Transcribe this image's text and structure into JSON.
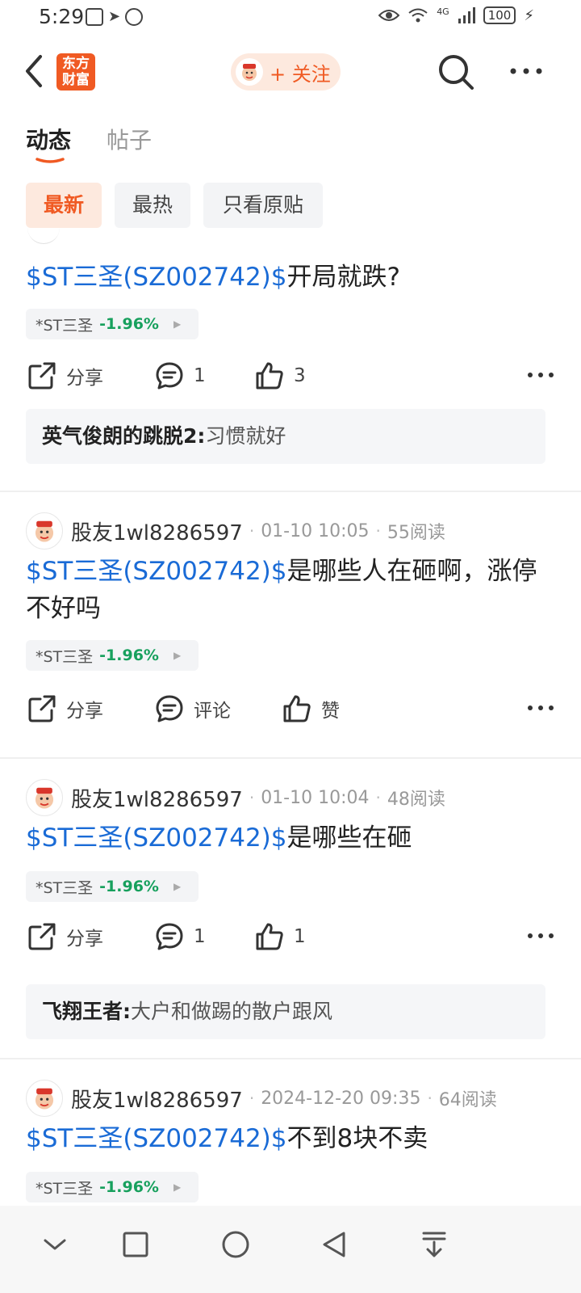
{
  "status_bar": {
    "time": "5:29",
    "network": "4G",
    "battery": "100"
  },
  "header": {
    "logo_line1": "东方",
    "logo_line2": "财富",
    "follow_label": "+ 关注"
  },
  "tabs": [
    {
      "label": "动态"
    },
    {
      "label": "帖子"
    }
  ],
  "filters": [
    {
      "label": "最新"
    },
    {
      "label": "最热"
    },
    {
      "label": "只看原贴"
    }
  ],
  "posts": [
    {
      "stock_code": "$ST三圣(SZ002742)$",
      "text": "开局就跌?",
      "tag_name": "*ST三圣",
      "tag_change": "-1.96%",
      "share_label": "分享",
      "comment_label": "1",
      "like_label": "3",
      "comment_author": "英气俊朗的跳脱2:",
      "comment_text": "习惯就好"
    },
    {
      "author": "股友1wl8286597",
      "time": "01-10 10:05",
      "reads": "55阅读",
      "stock_code": "$ST三圣(SZ002742)$",
      "text": "是哪些人在砸啊，涨停不好吗",
      "tag_name": "*ST三圣",
      "tag_change": "-1.96%",
      "share_label": "分享",
      "comment_label": "评论",
      "like_label": "赞"
    },
    {
      "author": "股友1wl8286597",
      "time": "01-10 10:04",
      "reads": "48阅读",
      "stock_code": "$ST三圣(SZ002742)$",
      "text": "是哪些在砸",
      "tag_name": "*ST三圣",
      "tag_change": "-1.96%",
      "share_label": "分享",
      "comment_label": "1",
      "like_label": "1",
      "comment_author": "飞翔王者:",
      "comment_text": "大户和做踢的散户跟风"
    },
    {
      "author": "股友1wl8286597",
      "time": "2024-12-20 09:35",
      "reads": "64阅读",
      "stock_code": "$ST三圣(SZ002742)$",
      "text": "不到8块不卖",
      "tag_name": "*ST三圣",
      "tag_change": "-1.96%"
    }
  ],
  "colors": {
    "accent": "#f05a23",
    "stock_link": "#1a6bd6",
    "down": "#17a05d"
  }
}
